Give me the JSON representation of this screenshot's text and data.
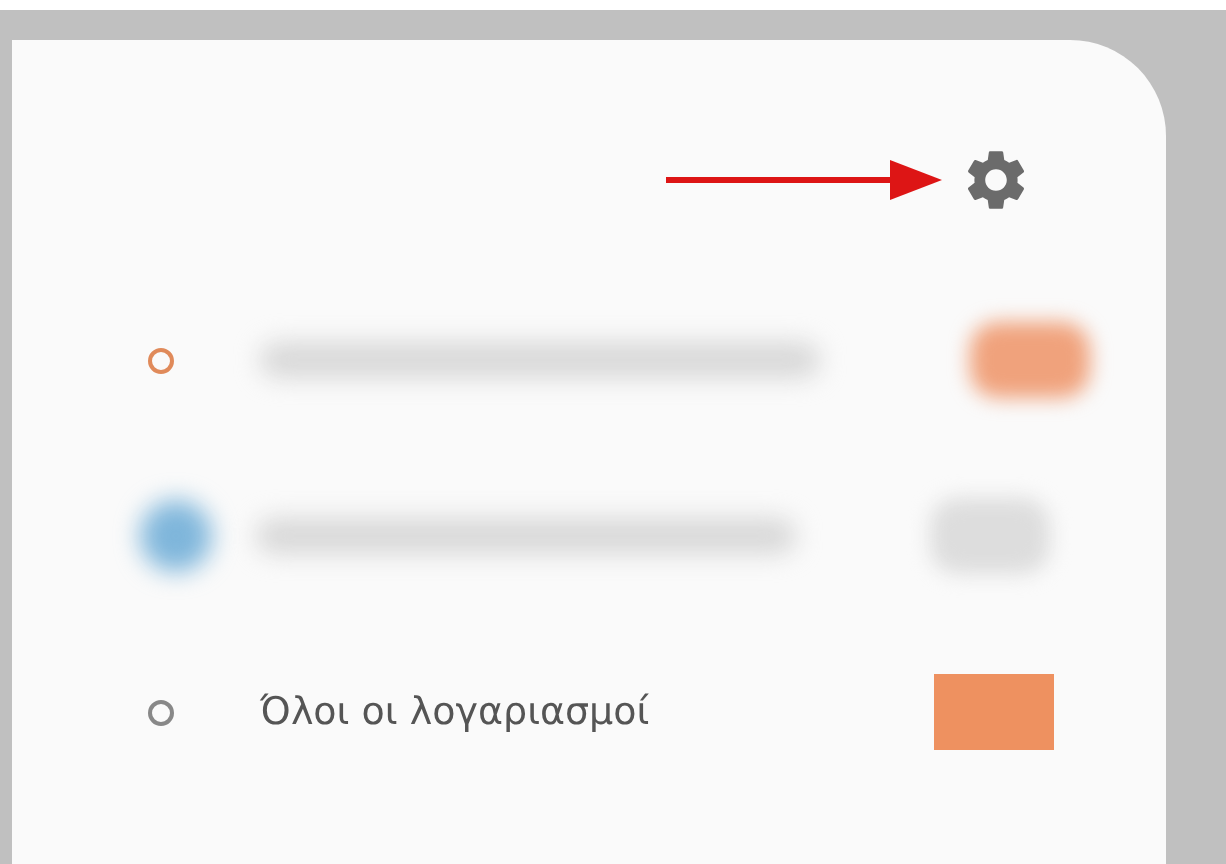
{
  "accounts": [
    {
      "kind": "radio",
      "color": "#e08a5a"
    },
    {
      "kind": "avatar",
      "color": "#7fb6db"
    },
    {
      "kind": "label",
      "color": "#888888",
      "label": "Όλοι οι λογαριασμοί"
    }
  ]
}
